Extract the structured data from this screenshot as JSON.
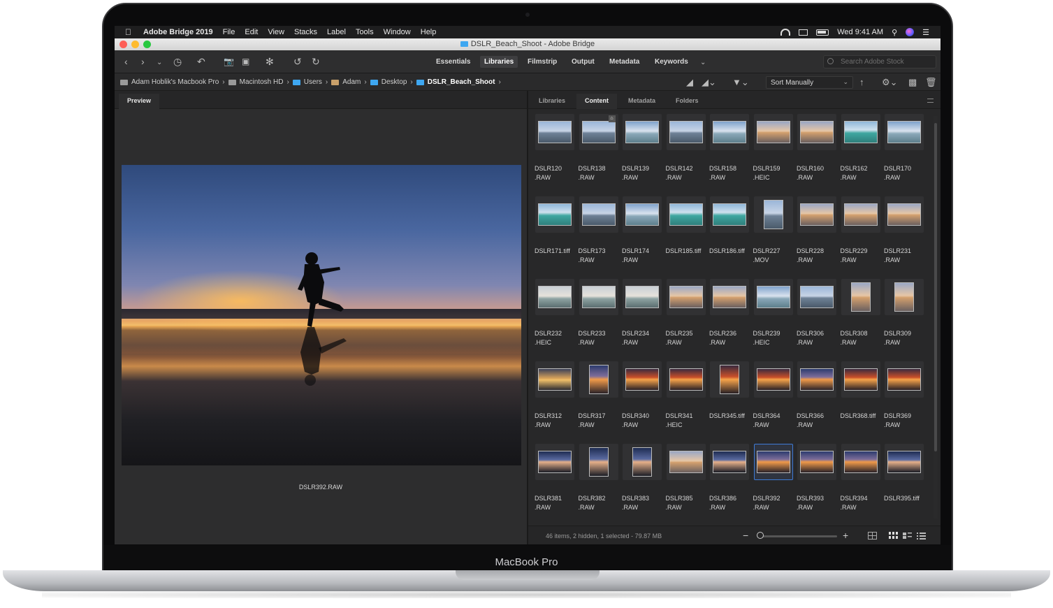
{
  "device": {
    "brand": "MacBook Pro"
  },
  "menubar": {
    "app": "Adobe Bridge 2019",
    "items": [
      "File",
      "Edit",
      "View",
      "Stacks",
      "Label",
      "Tools",
      "Window",
      "Help"
    ],
    "clock": "Wed 9:41 AM"
  },
  "window": {
    "title": "DSLR_Beach_Shoot - Adobe Bridge"
  },
  "toolbar": {
    "workspaces": [
      "Essentials",
      "Libraries",
      "Filmstrip",
      "Output",
      "Metadata",
      "Keywords"
    ],
    "active_workspace": "Libraries",
    "search_placeholder": "Search Adobe Stock"
  },
  "path": {
    "crumbs": [
      "Adam Hoblik's Macbook Pro",
      "Macintosh HD",
      "Users",
      "Adam",
      "Desktop",
      "DSLR_Beach_Shoot"
    ],
    "sort": "Sort Manually"
  },
  "preview": {
    "tab": "Preview",
    "filename": "DSLR392.RAW"
  },
  "content": {
    "tabs": [
      "Libraries",
      "Content",
      "Metadata",
      "Folders"
    ],
    "active_tab": "Content",
    "items": [
      {
        "name": "DSLR120",
        "ext": ".RAW",
        "tone": "blue"
      },
      {
        "name": "DSLR138",
        "ext": ".RAW",
        "tone": "blue",
        "badge": "crop"
      },
      {
        "name": "DSLR139",
        "ext": ".RAW",
        "tone": "sky"
      },
      {
        "name": "DSLR142",
        "ext": ".RAW",
        "tone": "blue"
      },
      {
        "name": "DSLR158",
        "ext": ".RAW",
        "tone": "sky"
      },
      {
        "name": "DSLR159",
        "ext": ".HEIC",
        "tone": "dusk"
      },
      {
        "name": "DSLR160",
        "ext": ".RAW",
        "tone": "dusk"
      },
      {
        "name": "DSLR162",
        "ext": ".RAW",
        "tone": "teal"
      },
      {
        "name": "DSLR170",
        "ext": ".RAW",
        "tone": "sky"
      },
      {
        "name": "DSLR171.tiff",
        "ext": "",
        "tone": "teal"
      },
      {
        "name": "DSLR173",
        "ext": ".RAW",
        "tone": "blue"
      },
      {
        "name": "DSLR174",
        "ext": ".RAW",
        "tone": "sky"
      },
      {
        "name": "DSLR185.tiff",
        "ext": "",
        "tone": "teal"
      },
      {
        "name": "DSLR186.tiff",
        "ext": "",
        "tone": "teal"
      },
      {
        "name": "DSLR227",
        "ext": ".MOV",
        "tone": "blue",
        "portrait": true
      },
      {
        "name": "DSLR228",
        "ext": ".RAW",
        "tone": "dusk"
      },
      {
        "name": "DSLR229",
        "ext": ".RAW",
        "tone": "dusk"
      },
      {
        "name": "DSLR231",
        "ext": ".RAW",
        "tone": "dusk"
      },
      {
        "name": "DSLR232",
        "ext": ".HEIC",
        "tone": "sea"
      },
      {
        "name": "DSLR233",
        "ext": ".RAW",
        "tone": "sea"
      },
      {
        "name": "DSLR234",
        "ext": ".RAW",
        "tone": "sea"
      },
      {
        "name": "DSLR235",
        "ext": ".RAW",
        "tone": "dusk"
      },
      {
        "name": "DSLR236",
        "ext": ".RAW",
        "tone": "dusk"
      },
      {
        "name": "DSLR239",
        "ext": ".HEIC",
        "tone": "sky"
      },
      {
        "name": "DSLR306",
        "ext": ".RAW",
        "tone": "blue"
      },
      {
        "name": "DSLR308",
        "ext": ".RAW",
        "tone": "dusk",
        "portrait": true
      },
      {
        "name": "DSLR309",
        "ext": ".RAW",
        "tone": "dusk",
        "portrait": true
      },
      {
        "name": "DSLR312",
        "ext": ".RAW",
        "tone": "gold"
      },
      {
        "name": "DSLR317",
        "ext": ".RAW",
        "tone": "sunset",
        "portrait": true
      },
      {
        "name": "DSLR340",
        "ext": ".RAW",
        "tone": "fire"
      },
      {
        "name": "DSLR341",
        "ext": ".HEIC",
        "tone": "fire"
      },
      {
        "name": "DSLR345.tiff",
        "ext": "",
        "tone": "fire",
        "portrait": true
      },
      {
        "name": "DSLR364",
        "ext": ".RAW",
        "tone": "fire"
      },
      {
        "name": "DSLR366",
        "ext": ".RAW",
        "tone": "sunset"
      },
      {
        "name": "DSLR368.tiff",
        "ext": "",
        "tone": "fire"
      },
      {
        "name": "DSLR369",
        "ext": ".RAW",
        "tone": "fire"
      },
      {
        "name": "DSLR381",
        "ext": ".RAW",
        "tone": "night"
      },
      {
        "name": "DSLR382",
        "ext": ".RAW",
        "tone": "night",
        "portrait": true
      },
      {
        "name": "DSLR383",
        "ext": ".RAW",
        "tone": "night",
        "portrait": true
      },
      {
        "name": "DSLR385",
        "ext": ".RAW",
        "tone": "dusk"
      },
      {
        "name": "DSLR386",
        "ext": ".RAW",
        "tone": "night"
      },
      {
        "name": "DSLR392",
        "ext": ".RAW",
        "tone": "sunset",
        "selected": true
      },
      {
        "name": "DSLR393",
        "ext": ".RAW",
        "tone": "sunset"
      },
      {
        "name": "DSLR394",
        "ext": ".RAW",
        "tone": "sunset"
      },
      {
        "name": "DSLR395.tiff",
        "ext": "",
        "tone": "night"
      }
    ],
    "status": "46 items, 2 hidden, 1 selected - 79.87 MB",
    "zoom_level": 0.0
  },
  "colors": {
    "accent": "#3e7bd6",
    "folder": "#3ea7f1"
  },
  "tones": {
    "blue": "linear-gradient(#9bb6d8 0%, #c8d4e6 45%, #6e8196 55%, #4a5a6a 100%)",
    "sky": "linear-gradient(#7fa2cc 0%, #d9e2ee 45%, #8aa7b8 58%, #5d7f8c 100%)",
    "teal": "linear-gradient(#8fb7d9 0%, #cfe1ee 40%, #3fa7a0 55%, #2f7f7c 100%)",
    "sea": "linear-gradient(#c9cfd6 0%, #e6e2db 45%, #8ea3a3 58%, #5b6e70 100%)",
    "dusk": "linear-gradient(#9aa7c4 0%, #e6c6a6 45%, #d3a06e 52%, #6b6060 100%)",
    "gold": "linear-gradient(#3b4058 0%, #d9a35a 45%, #f0c06a 52%, #2a2a30 100%)",
    "sunset": "linear-gradient(#2c3b6e 0%, #7d6d9a 38%, #f09a4a 50%, #2a2228 100%)",
    "fire": "linear-gradient(#3a2a3e 0%, #c9502a 40%, #f6a34a 50%, #281f24 100%)",
    "night": "linear-gradient(#1e2c52 0%, #5a6aa0 40%, #e6b08a 50%, #1a1c26 100%)"
  }
}
